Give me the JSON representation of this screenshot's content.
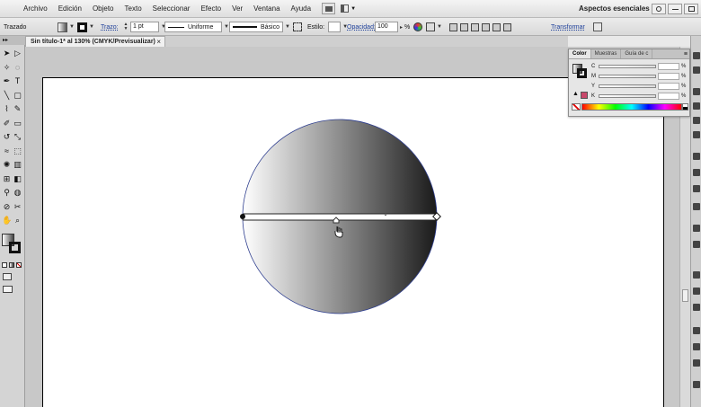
{
  "menubar": {
    "items": [
      "Archivo",
      "Edición",
      "Objeto",
      "Texto",
      "Seleccionar",
      "Efecto",
      "Ver",
      "Ventana",
      "Ayuda"
    ],
    "bridge_icon": "br-icon",
    "arrange_icon": "arrange-documents-icon",
    "workspace": "Aspectos esenciales",
    "workspace_arrow": "▼",
    "search_icon": "search-icon"
  },
  "controlbar": {
    "selection_label": "Trazado",
    "stroke_link": "Trazo:",
    "stroke_weight": "1 pt",
    "profile_label": "Uniforme",
    "brush_label": "Básico",
    "style_label": "Estilo:",
    "opacity_link": "Opacidad:",
    "opacity_value": "100",
    "opacity_unit": "%",
    "transform_link": "Transformar"
  },
  "document": {
    "tab_title": "Sin título-1* al 130% (CMYK/Previsualizar)",
    "close": "×"
  },
  "tools": {
    "head": "▸▸",
    "icons": [
      "selection-tool",
      "direct-selection-tool",
      "magic-wand-tool",
      "lasso-tool",
      "pen-tool",
      "type-tool",
      "line-tool",
      "rectangle-tool",
      "paintbrush-tool",
      "pencil-tool",
      "blob-brush-tool",
      "eraser-tool",
      "rotate-tool",
      "scale-tool",
      "warp-tool",
      "free-transform-tool",
      "symbol-sprayer-tool",
      "column-graph-tool",
      "mesh-tool",
      "gradient-tool",
      "eyedropper-tool",
      "blend-tool",
      "slice-tool",
      "scissors-tool",
      "hand-tool",
      "zoom-tool"
    ]
  },
  "colorpanel": {
    "tabs": [
      "Color",
      "Muestras",
      "Guía de c"
    ],
    "menu": "≡",
    "channels": [
      {
        "label": "C",
        "unit": "%"
      },
      {
        "label": "M",
        "unit": "%"
      },
      {
        "label": "Y",
        "unit": "%"
      },
      {
        "label": "K",
        "unit": "%"
      }
    ],
    "out_of_gamut_color": "#c8476a"
  },
  "artwork": {
    "gradient_start": "#ffffff",
    "gradient_end": "#1a1a1a",
    "bar_color": "#ffffff",
    "path_color": "#2f3f8f"
  }
}
